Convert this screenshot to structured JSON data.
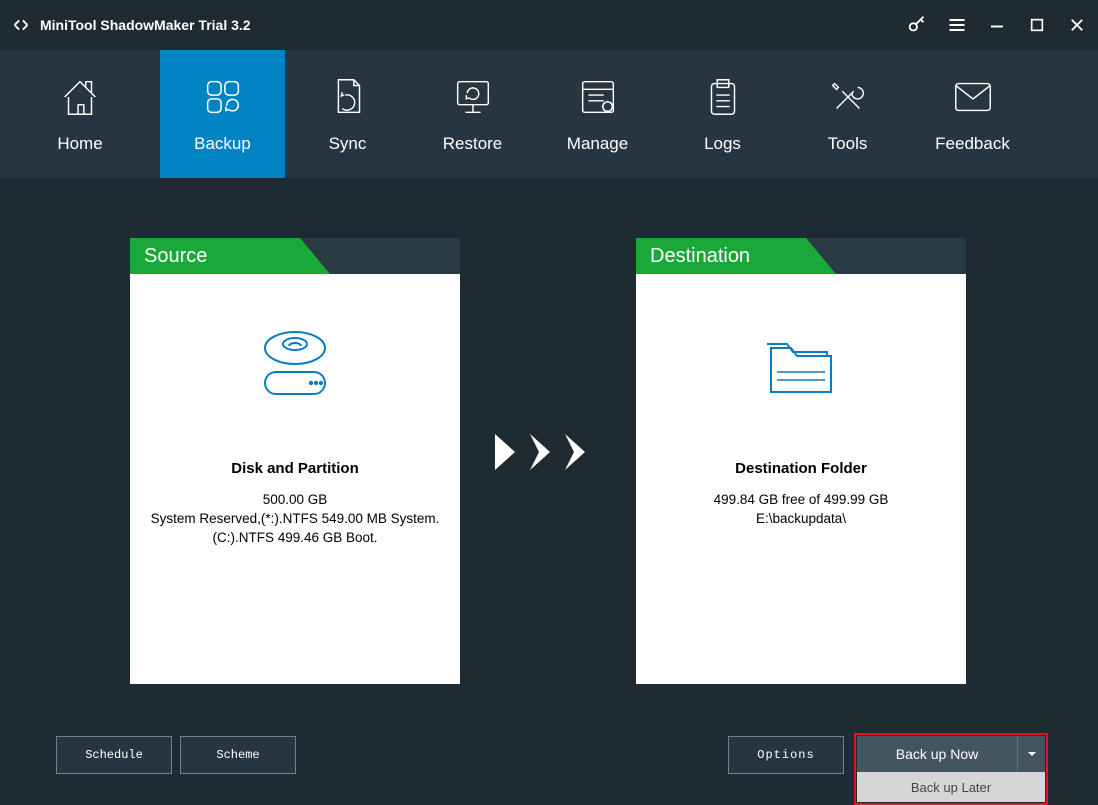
{
  "app_title": "MiniTool ShadowMaker Trial 3.2",
  "nav": {
    "home": "Home",
    "backup": "Backup",
    "sync": "Sync",
    "restore": "Restore",
    "manage": "Manage",
    "logs": "Logs",
    "tools": "Tools",
    "feedback": "Feedback",
    "active": "backup"
  },
  "source": {
    "header": "Source",
    "title": "Disk and Partition",
    "size": "500.00 GB",
    "detail1": "System Reserved,(*:).NTFS 549.00 MB System.",
    "detail2": "(C:).NTFS 499.46 GB Boot."
  },
  "destination": {
    "header": "Destination",
    "title": "Destination Folder",
    "size": "499.84 GB free of 499.99 GB",
    "path": "E:\\backupdata\\"
  },
  "buttons": {
    "schedule": "Schedule",
    "scheme": "Scheme",
    "options": "Options",
    "backup_now": "Back up Now",
    "backup_later": "Back up Later"
  }
}
